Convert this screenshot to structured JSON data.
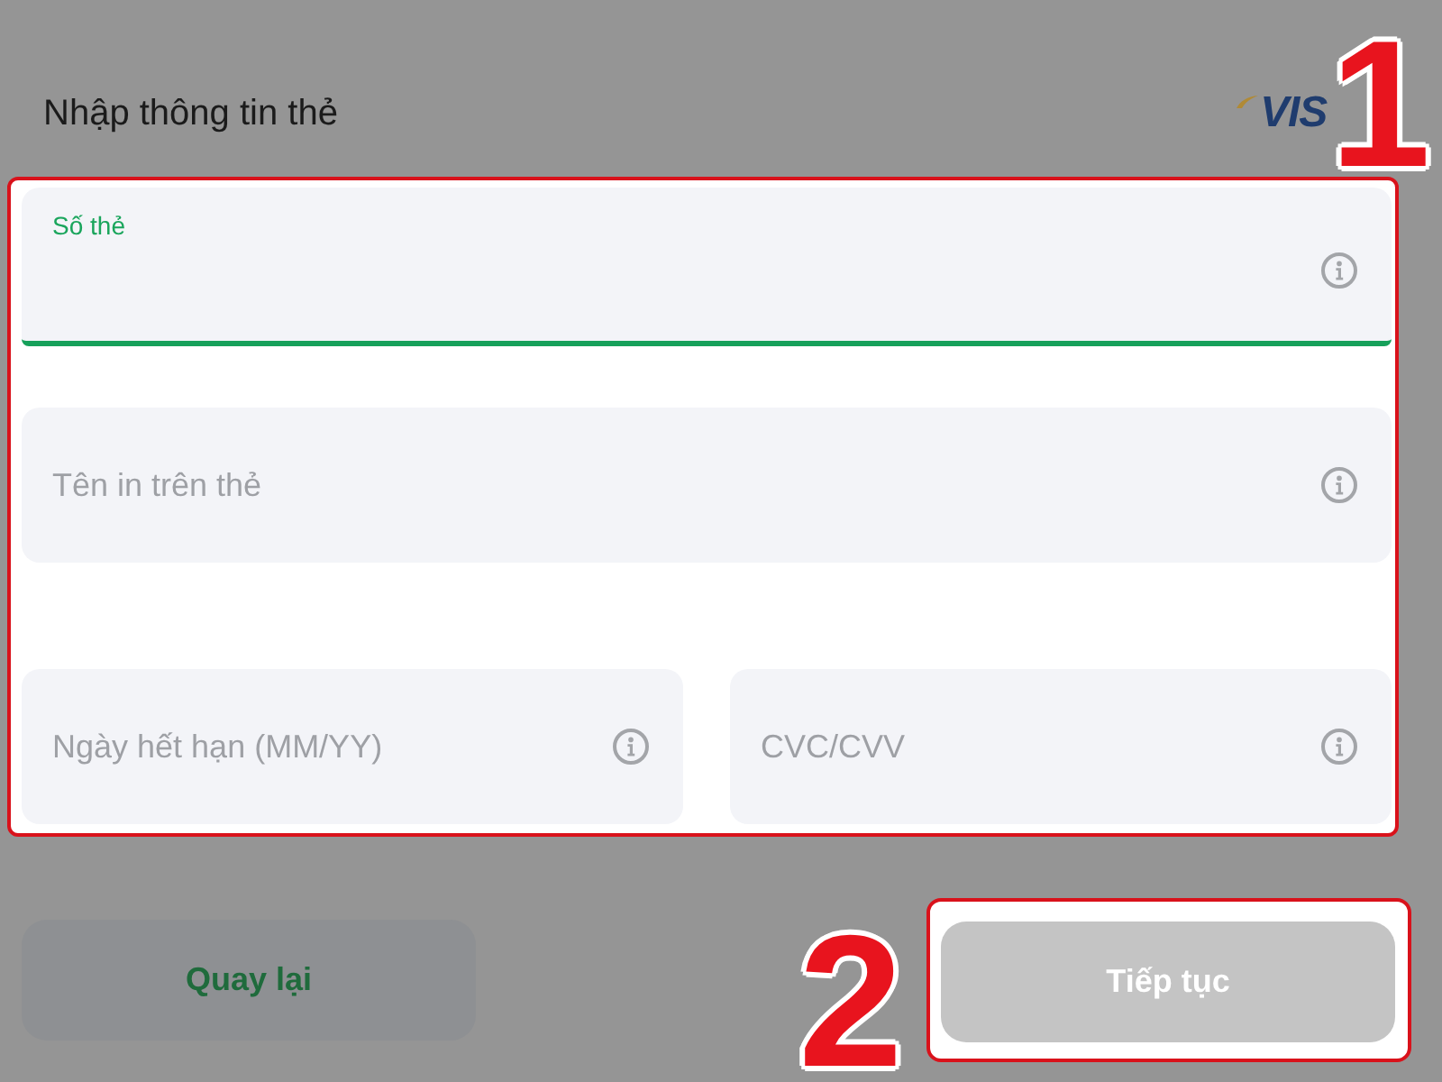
{
  "header": {
    "title": "Nhập thông tin thẻ",
    "card_brand": "VIS"
  },
  "form": {
    "highlighted": true,
    "rows": [
      {
        "fields": [
          {
            "label": "Số thẻ",
            "focused": true
          }
        ]
      },
      {
        "fields": [
          {
            "placeholder": "Tên in trên thẻ",
            "focused": false
          }
        ]
      },
      {
        "fields": [
          {
            "placeholder": "Ngày hết hạn (MM/YY)",
            "focused": false
          },
          {
            "placeholder": "CVC/CVV",
            "focused": false
          }
        ]
      }
    ]
  },
  "buttons": [
    {
      "label": "Quay lại",
      "kind": "secondary",
      "disabled": false,
      "highlighted": false
    },
    {
      "label": "Tiếp tục",
      "kind": "primary",
      "disabled": true,
      "highlighted": true
    }
  ],
  "annotations": [
    {
      "label": "1"
    },
    {
      "label": "2"
    }
  ]
}
